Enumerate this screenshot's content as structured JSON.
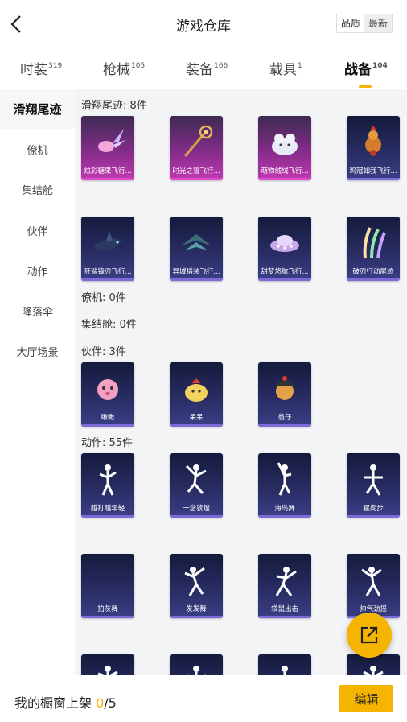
{
  "header": {
    "title": "游戏仓库",
    "sort_quality": "品质",
    "sort_latest": "最新"
  },
  "tabs": [
    {
      "label": "时装",
      "count": "319"
    },
    {
      "label": "枪械",
      "count": "105"
    },
    {
      "label": "装备",
      "count": "166"
    },
    {
      "label": "载具",
      "count": "1"
    },
    {
      "label": "战备",
      "count": "104"
    }
  ],
  "sidebar": [
    "滑翔尾迹",
    "僚机",
    "集结舱",
    "伙伴",
    "动作",
    "降落伞",
    "大厅场景"
  ],
  "sections": {
    "glide": {
      "title": "滑翔尾迹: 8件",
      "items": [
        "炫彩糖果飞行...",
        "时光之誓飞行...",
        "萌物绒绒飞行...",
        "鸡冠如我飞行...",
        "狂鲨锋刃飞行...",
        "异域猎装飞行...",
        "甜梦悠航飞行...",
        "破刃行动尾迹"
      ]
    },
    "wingman": {
      "title": "僚机: 0件"
    },
    "capsule": {
      "title": "集结舱: 0件"
    },
    "partner": {
      "title": "伙伴: 3件",
      "items": [
        "啾啾",
        "呆呆",
        "翁仔"
      ]
    },
    "emote": {
      "title": "动作: 55件",
      "items": [
        "越打越年轻",
        "一念敦煌",
        "海岛舞",
        "猩虎步",
        "拍灰舞",
        "发发舞",
        "袋鼠出击",
        "帅气劲摇"
      ]
    }
  },
  "bottom": {
    "text": "我的橱窗上架 ",
    "current": "0",
    "sep": "/",
    "total": "5",
    "edit": "编辑"
  },
  "colors": {
    "accent": "#f5b400"
  }
}
